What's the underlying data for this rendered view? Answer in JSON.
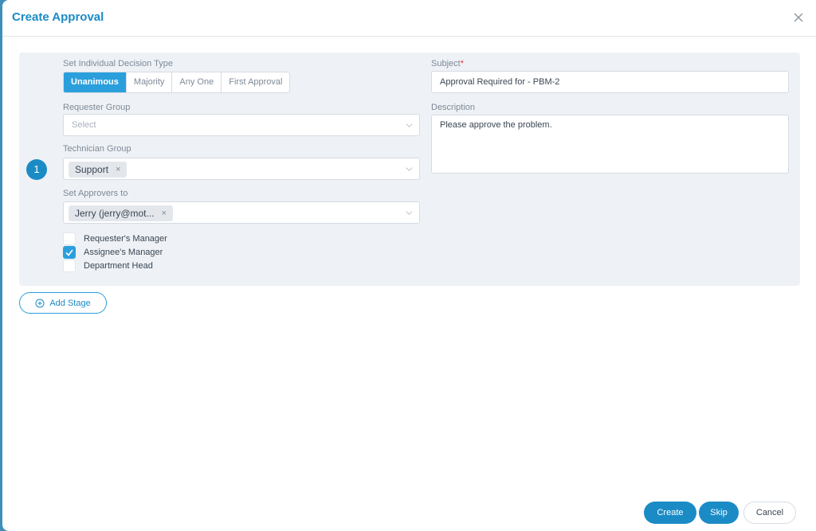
{
  "modal": {
    "title": "Create Approval",
    "close_glyph": "X"
  },
  "stage": {
    "number": "1",
    "decision_type": {
      "label": "Set Individual Decision Type",
      "options": [
        "Unanimous",
        "Majority",
        "Any One",
        "First Approval"
      ],
      "selected": "Unanimous"
    },
    "requester_group": {
      "label": "Requester Group",
      "placeholder": "Select"
    },
    "technician_group": {
      "label": "Technician Group",
      "tag": "Support",
      "tag_remove": "×"
    },
    "approvers": {
      "label": "Set Approvers to",
      "tag": "Jerry (jerry@mot...",
      "tag_remove": "×"
    },
    "checkboxes": [
      {
        "label": "Requester's Manager",
        "checked": false
      },
      {
        "label": "Assignee's Manager",
        "checked": true
      },
      {
        "label": "Department Head",
        "checked": false
      }
    ],
    "subject": {
      "label": "Subject",
      "required_marker": "*",
      "value": "Approval Required for - PBM-2"
    },
    "description": {
      "label": "Description",
      "value": "Please approve the problem."
    }
  },
  "actions": {
    "add_stage": "Add Stage",
    "create": "Create",
    "skip": "Skip",
    "cancel": "Cancel"
  },
  "icons": {
    "close": "close-icon",
    "chevron": "chevron-down-icon",
    "add": "plus-circle-icon",
    "check": "check-icon"
  },
  "colors": {
    "accent": "#1b8bc6",
    "accent_light": "#2a9fdc",
    "stage_bg": "#eef1f5",
    "required": "#e23d3d"
  }
}
